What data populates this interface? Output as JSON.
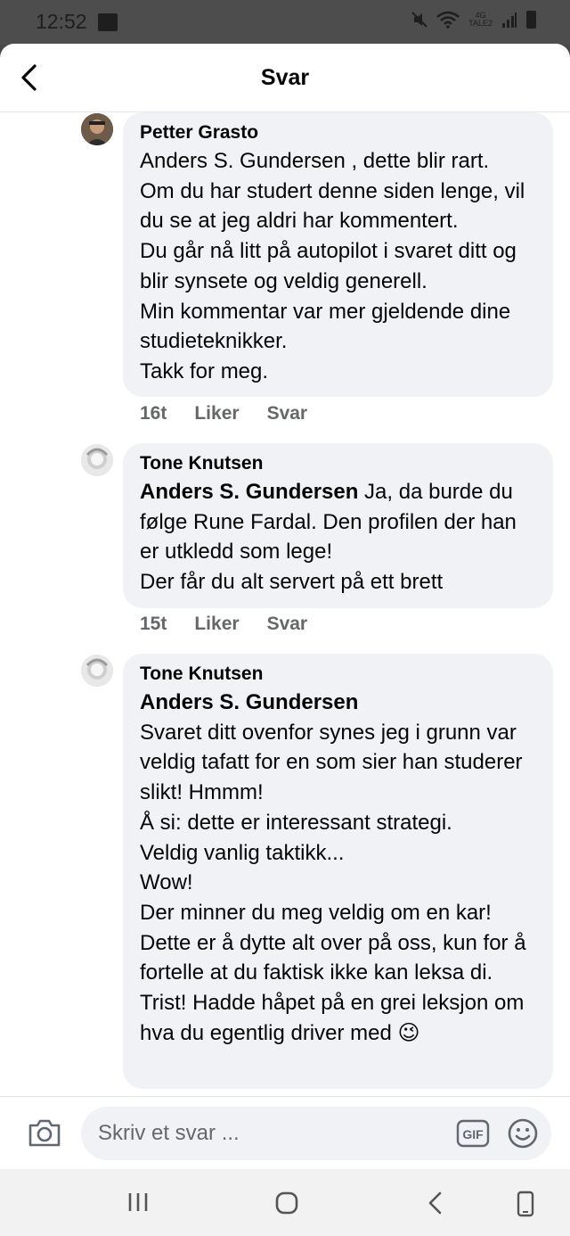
{
  "status": {
    "time": "12:52",
    "network": "4G",
    "network_sub": "TALE2"
  },
  "header": {
    "title": "Svar"
  },
  "comments": [
    {
      "author": "Petter Grasto",
      "mention": "",
      "text": "Anders S. Gundersen , dette blir rart.\nOm du har studert denne siden lenge, vil du se at jeg aldri har kommentert.\nDu går nå litt på autopilot i svaret ditt og blir synsete og veldig generell.\nMin kommentar var mer gjeldende dine studieteknikker.\nTakk for meg.",
      "time": "16t",
      "like_label": "Liker",
      "reply_label": "Svar"
    },
    {
      "author": "Tone Knutsen",
      "mention": "Anders S. Gundersen",
      "text": " Ja, da burde du følge Rune Fardal. Den profilen der han er utkledd som lege!\nDer får du alt servert på ett brett",
      "time": "15t",
      "like_label": "Liker",
      "reply_label": "Svar"
    },
    {
      "author": "Tone Knutsen",
      "mention": "Anders S. Gundersen",
      "text": "\nSvaret ditt ovenfor synes jeg i grunn var veldig tafatt for en som sier han studerer slikt! Hmmm!\nÅ si: dette er interessant strategi.\nVeldig vanlig taktikk...\nWow!\nDer minner du meg veldig om en kar!\nDette er å dytte alt over på oss, kun for å fortelle at du faktisk ikke kan leksa di.\nTrist! Hadde håpet på en grei leksjon om hva du egentlig driver med 😉"
    }
  ],
  "composer": {
    "placeholder": "Skriv et svar ..."
  },
  "colors": {
    "bubble": "#f0f2f5",
    "meta": "#65676b",
    "text": "#050505"
  }
}
